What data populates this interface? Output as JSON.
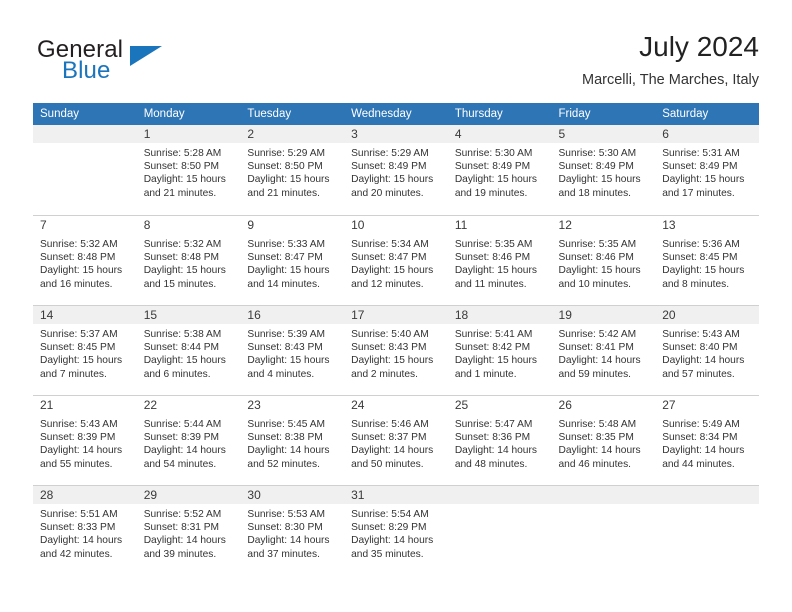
{
  "brand": {
    "name_part1": "General",
    "name_part2": "Blue",
    "flag_icon": "triangle-flag-icon"
  },
  "header": {
    "title": "July 2024",
    "location": "Marcelli, The Marches, Italy"
  },
  "calendar": {
    "weekday_headers": [
      "Sunday",
      "Monday",
      "Tuesday",
      "Wednesday",
      "Thursday",
      "Friday",
      "Saturday"
    ],
    "accent_color": "#2e75b6",
    "shaded_row_color": "#f0f0f0",
    "weeks": [
      [
        {
          "day": "",
          "sunrise": "",
          "sunset": "",
          "daylight1": "",
          "daylight2": ""
        },
        {
          "day": "1",
          "sunrise": "Sunrise: 5:28 AM",
          "sunset": "Sunset: 8:50 PM",
          "daylight1": "Daylight: 15 hours",
          "daylight2": "and 21 minutes."
        },
        {
          "day": "2",
          "sunrise": "Sunrise: 5:29 AM",
          "sunset": "Sunset: 8:50 PM",
          "daylight1": "Daylight: 15 hours",
          "daylight2": "and 21 minutes."
        },
        {
          "day": "3",
          "sunrise": "Sunrise: 5:29 AM",
          "sunset": "Sunset: 8:49 PM",
          "daylight1": "Daylight: 15 hours",
          "daylight2": "and 20 minutes."
        },
        {
          "day": "4",
          "sunrise": "Sunrise: 5:30 AM",
          "sunset": "Sunset: 8:49 PM",
          "daylight1": "Daylight: 15 hours",
          "daylight2": "and 19 minutes."
        },
        {
          "day": "5",
          "sunrise": "Sunrise: 5:30 AM",
          "sunset": "Sunset: 8:49 PM",
          "daylight1": "Daylight: 15 hours",
          "daylight2": "and 18 minutes."
        },
        {
          "day": "6",
          "sunrise": "Sunrise: 5:31 AM",
          "sunset": "Sunset: 8:49 PM",
          "daylight1": "Daylight: 15 hours",
          "daylight2": "and 17 minutes."
        }
      ],
      [
        {
          "day": "7",
          "sunrise": "Sunrise: 5:32 AM",
          "sunset": "Sunset: 8:48 PM",
          "daylight1": "Daylight: 15 hours",
          "daylight2": "and 16 minutes."
        },
        {
          "day": "8",
          "sunrise": "Sunrise: 5:32 AM",
          "sunset": "Sunset: 8:48 PM",
          "daylight1": "Daylight: 15 hours",
          "daylight2": "and 15 minutes."
        },
        {
          "day": "9",
          "sunrise": "Sunrise: 5:33 AM",
          "sunset": "Sunset: 8:47 PM",
          "daylight1": "Daylight: 15 hours",
          "daylight2": "and 14 minutes."
        },
        {
          "day": "10",
          "sunrise": "Sunrise: 5:34 AM",
          "sunset": "Sunset: 8:47 PM",
          "daylight1": "Daylight: 15 hours",
          "daylight2": "and 12 minutes."
        },
        {
          "day": "11",
          "sunrise": "Sunrise: 5:35 AM",
          "sunset": "Sunset: 8:46 PM",
          "daylight1": "Daylight: 15 hours",
          "daylight2": "and 11 minutes."
        },
        {
          "day": "12",
          "sunrise": "Sunrise: 5:35 AM",
          "sunset": "Sunset: 8:46 PM",
          "daylight1": "Daylight: 15 hours",
          "daylight2": "and 10 minutes."
        },
        {
          "day": "13",
          "sunrise": "Sunrise: 5:36 AM",
          "sunset": "Sunset: 8:45 PM",
          "daylight1": "Daylight: 15 hours",
          "daylight2": "and 8 minutes."
        }
      ],
      [
        {
          "day": "14",
          "sunrise": "Sunrise: 5:37 AM",
          "sunset": "Sunset: 8:45 PM",
          "daylight1": "Daylight: 15 hours",
          "daylight2": "and 7 minutes."
        },
        {
          "day": "15",
          "sunrise": "Sunrise: 5:38 AM",
          "sunset": "Sunset: 8:44 PM",
          "daylight1": "Daylight: 15 hours",
          "daylight2": "and 6 minutes."
        },
        {
          "day": "16",
          "sunrise": "Sunrise: 5:39 AM",
          "sunset": "Sunset: 8:43 PM",
          "daylight1": "Daylight: 15 hours",
          "daylight2": "and 4 minutes."
        },
        {
          "day": "17",
          "sunrise": "Sunrise: 5:40 AM",
          "sunset": "Sunset: 8:43 PM",
          "daylight1": "Daylight: 15 hours",
          "daylight2": "and 2 minutes."
        },
        {
          "day": "18",
          "sunrise": "Sunrise: 5:41 AM",
          "sunset": "Sunset: 8:42 PM",
          "daylight1": "Daylight: 15 hours",
          "daylight2": "and 1 minute."
        },
        {
          "day": "19",
          "sunrise": "Sunrise: 5:42 AM",
          "sunset": "Sunset: 8:41 PM",
          "daylight1": "Daylight: 14 hours",
          "daylight2": "and 59 minutes."
        },
        {
          "day": "20",
          "sunrise": "Sunrise: 5:43 AM",
          "sunset": "Sunset: 8:40 PM",
          "daylight1": "Daylight: 14 hours",
          "daylight2": "and 57 minutes."
        }
      ],
      [
        {
          "day": "21",
          "sunrise": "Sunrise: 5:43 AM",
          "sunset": "Sunset: 8:39 PM",
          "daylight1": "Daylight: 14 hours",
          "daylight2": "and 55 minutes."
        },
        {
          "day": "22",
          "sunrise": "Sunrise: 5:44 AM",
          "sunset": "Sunset: 8:39 PM",
          "daylight1": "Daylight: 14 hours",
          "daylight2": "and 54 minutes."
        },
        {
          "day": "23",
          "sunrise": "Sunrise: 5:45 AM",
          "sunset": "Sunset: 8:38 PM",
          "daylight1": "Daylight: 14 hours",
          "daylight2": "and 52 minutes."
        },
        {
          "day": "24",
          "sunrise": "Sunrise: 5:46 AM",
          "sunset": "Sunset: 8:37 PM",
          "daylight1": "Daylight: 14 hours",
          "daylight2": "and 50 minutes."
        },
        {
          "day": "25",
          "sunrise": "Sunrise: 5:47 AM",
          "sunset": "Sunset: 8:36 PM",
          "daylight1": "Daylight: 14 hours",
          "daylight2": "and 48 minutes."
        },
        {
          "day": "26",
          "sunrise": "Sunrise: 5:48 AM",
          "sunset": "Sunset: 8:35 PM",
          "daylight1": "Daylight: 14 hours",
          "daylight2": "and 46 minutes."
        },
        {
          "day": "27",
          "sunrise": "Sunrise: 5:49 AM",
          "sunset": "Sunset: 8:34 PM",
          "daylight1": "Daylight: 14 hours",
          "daylight2": "and 44 minutes."
        }
      ],
      [
        {
          "day": "28",
          "sunrise": "Sunrise: 5:51 AM",
          "sunset": "Sunset: 8:33 PM",
          "daylight1": "Daylight: 14 hours",
          "daylight2": "and 42 minutes."
        },
        {
          "day": "29",
          "sunrise": "Sunrise: 5:52 AM",
          "sunset": "Sunset: 8:31 PM",
          "daylight1": "Daylight: 14 hours",
          "daylight2": "and 39 minutes."
        },
        {
          "day": "30",
          "sunrise": "Sunrise: 5:53 AM",
          "sunset": "Sunset: 8:30 PM",
          "daylight1": "Daylight: 14 hours",
          "daylight2": "and 37 minutes."
        },
        {
          "day": "31",
          "sunrise": "Sunrise: 5:54 AM",
          "sunset": "Sunset: 8:29 PM",
          "daylight1": "Daylight: 14 hours",
          "daylight2": "and 35 minutes."
        },
        {
          "day": "",
          "sunrise": "",
          "sunset": "",
          "daylight1": "",
          "daylight2": ""
        },
        {
          "day": "",
          "sunrise": "",
          "sunset": "",
          "daylight1": "",
          "daylight2": ""
        },
        {
          "day": "",
          "sunrise": "",
          "sunset": "",
          "daylight1": "",
          "daylight2": ""
        }
      ]
    ]
  }
}
